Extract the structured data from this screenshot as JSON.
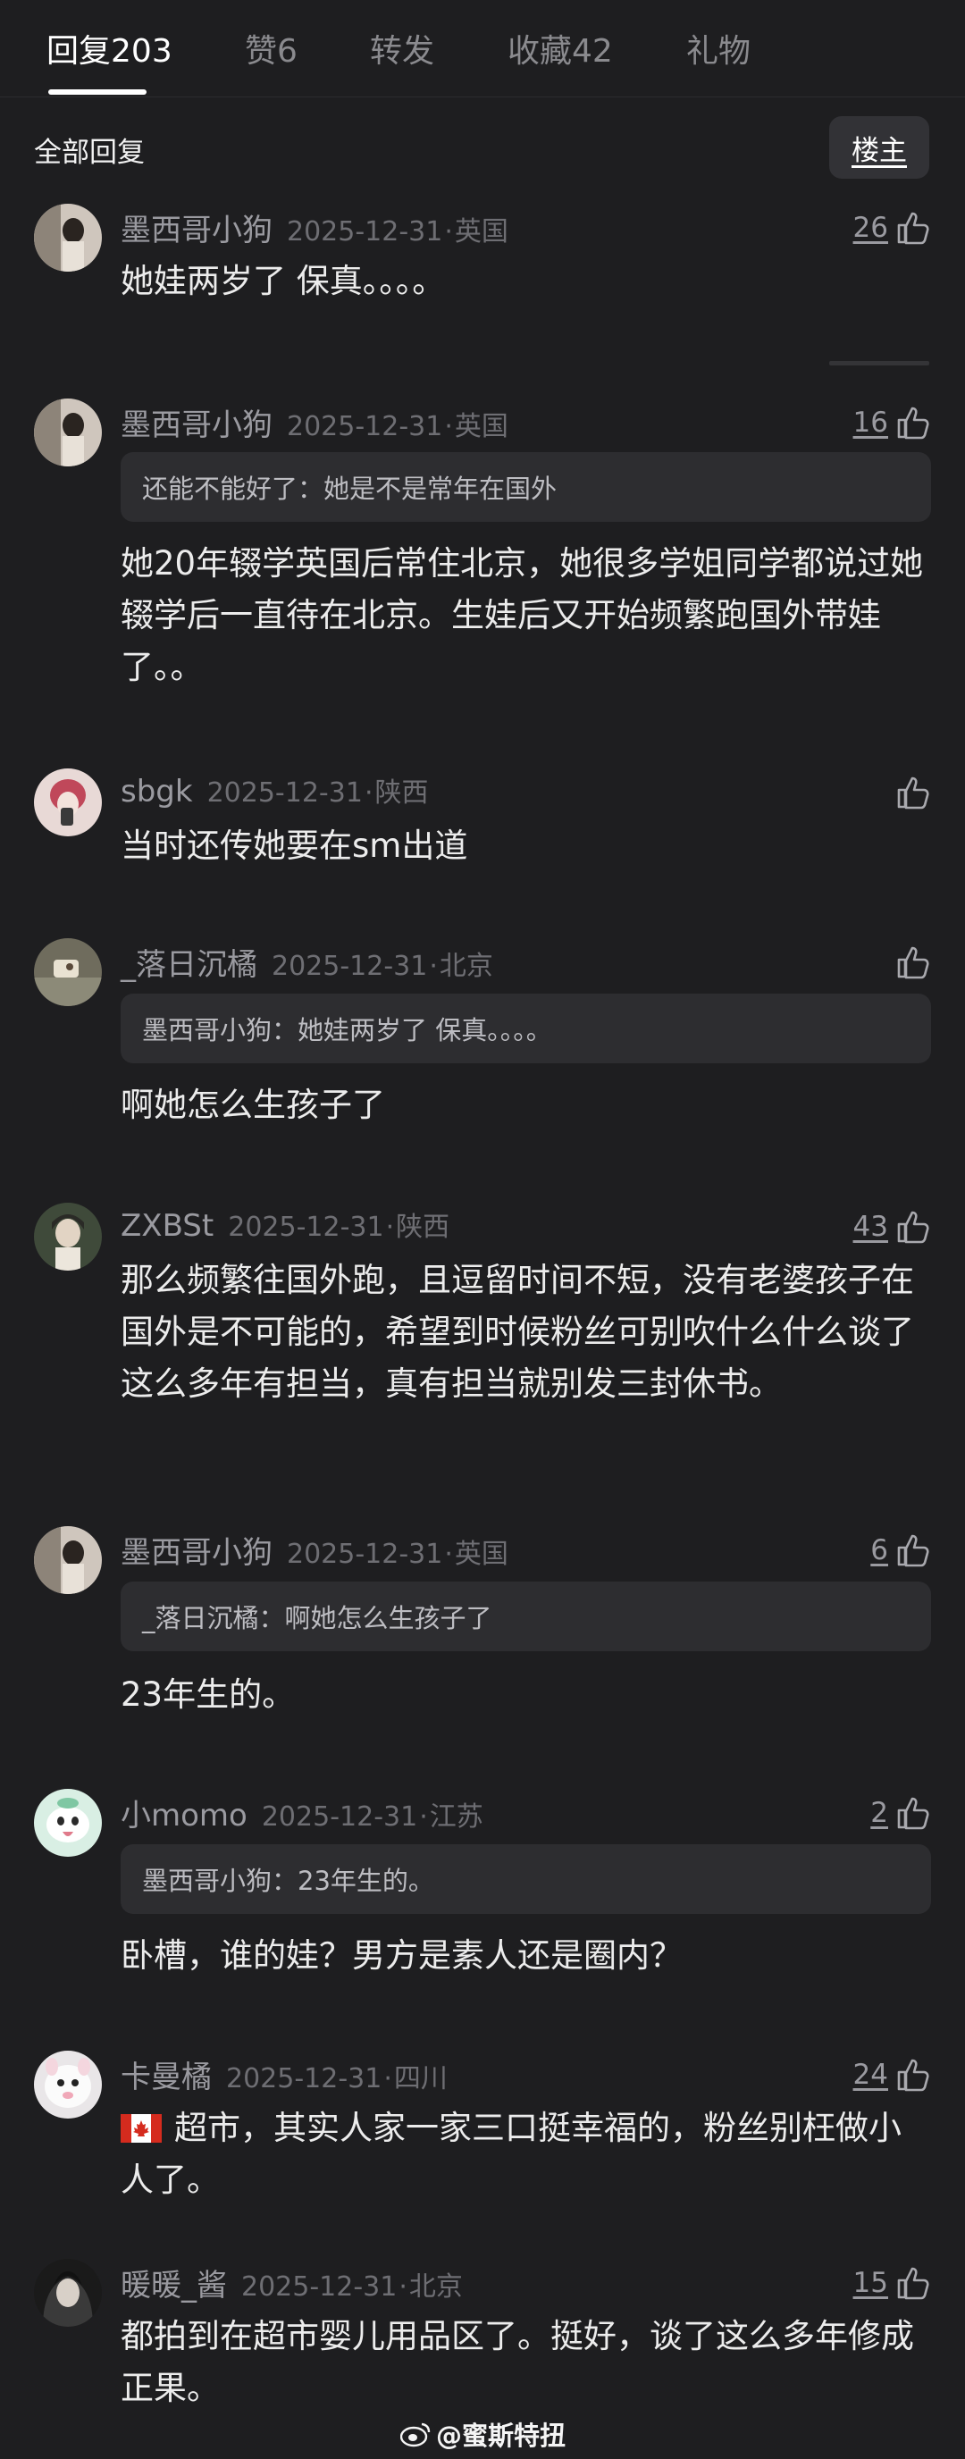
{
  "tabs": [
    {
      "label": "回复",
      "count": "203"
    },
    {
      "label": "赞",
      "count": "6"
    },
    {
      "label": "转发",
      "count": ""
    },
    {
      "label": "收藏",
      "count": "42"
    },
    {
      "label": "礼物",
      "count": ""
    }
  ],
  "header": {
    "all_replies": "全部回复",
    "owner_button": "楼主"
  },
  "comments": [
    {
      "user": "墨西哥小狗",
      "date": "2025-12-31",
      "location": "英国",
      "likes": "26",
      "quote_user": "",
      "quote_text": "",
      "text": "她娃两岁了 保真。。。。"
    },
    {
      "user": "墨西哥小狗",
      "date": "2025-12-31",
      "location": "英国",
      "likes": "16",
      "quote_user": "还能不能好了",
      "quote_text": "她是不是常年在国外",
      "text": "她20年辍学英国后常住北京，她很多学姐同学都说过她辍学后一直待在北京。生娃后又开始频繁跑国外带娃了。。"
    },
    {
      "user": "sbgk",
      "date": "2025-12-31",
      "location": "陕西",
      "likes": "",
      "quote_user": "",
      "quote_text": "",
      "text": "当时还传她要在sm出道"
    },
    {
      "user": "_落日沉橘",
      "date": "2025-12-31",
      "location": "北京",
      "likes": "",
      "quote_user": "墨西哥小狗",
      "quote_text": "她娃两岁了 保真。。。。",
      "text": "啊她怎么生孩子了"
    },
    {
      "user": "ZXBSt",
      "date": "2025-12-31",
      "location": "陕西",
      "likes": "43",
      "quote_user": "",
      "quote_text": "",
      "text": "那么频繁往国外跑，且逗留时间不短，没有老婆孩子在国外是不可能的，希望到时候粉丝可别吹什么什么谈了这么多年有担当，真有担当就别发三封休书。"
    },
    {
      "user": "墨西哥小狗",
      "date": "2025-12-31",
      "location": "英国",
      "likes": "6",
      "quote_user": "_落日沉橘",
      "quote_text": "啊她怎么生孩子了",
      "text": "23年生的。"
    },
    {
      "user": "小momo",
      "date": "2025-12-31",
      "location": "江苏",
      "likes": "2",
      "quote_user": "墨西哥小狗",
      "quote_text": "23年生的。",
      "text": "卧槽，谁的娃？男方是素人还是圈内？"
    },
    {
      "user": "卡曼橘",
      "date": "2025-12-31",
      "location": "四川",
      "likes": "24",
      "quote_user": "",
      "quote_text": "",
      "text": "超市，其实人家一家三口挺幸福的，粉丝别枉做小人了。"
    },
    {
      "user": "暖暖_酱",
      "date": "2025-12-31",
      "location": "北京",
      "likes": "15",
      "quote_user": "",
      "quote_text": "",
      "text": "都拍到在超市婴儿用品区了。挺好，谈了这么多年修成正果。"
    }
  ],
  "watermark": "@蜜斯特扭",
  "colors": {
    "background": "#1e1e20",
    "quote_bg": "#2d2d30",
    "active_tab": "#ffffff",
    "inactive_tab": "#8a8a8e"
  }
}
